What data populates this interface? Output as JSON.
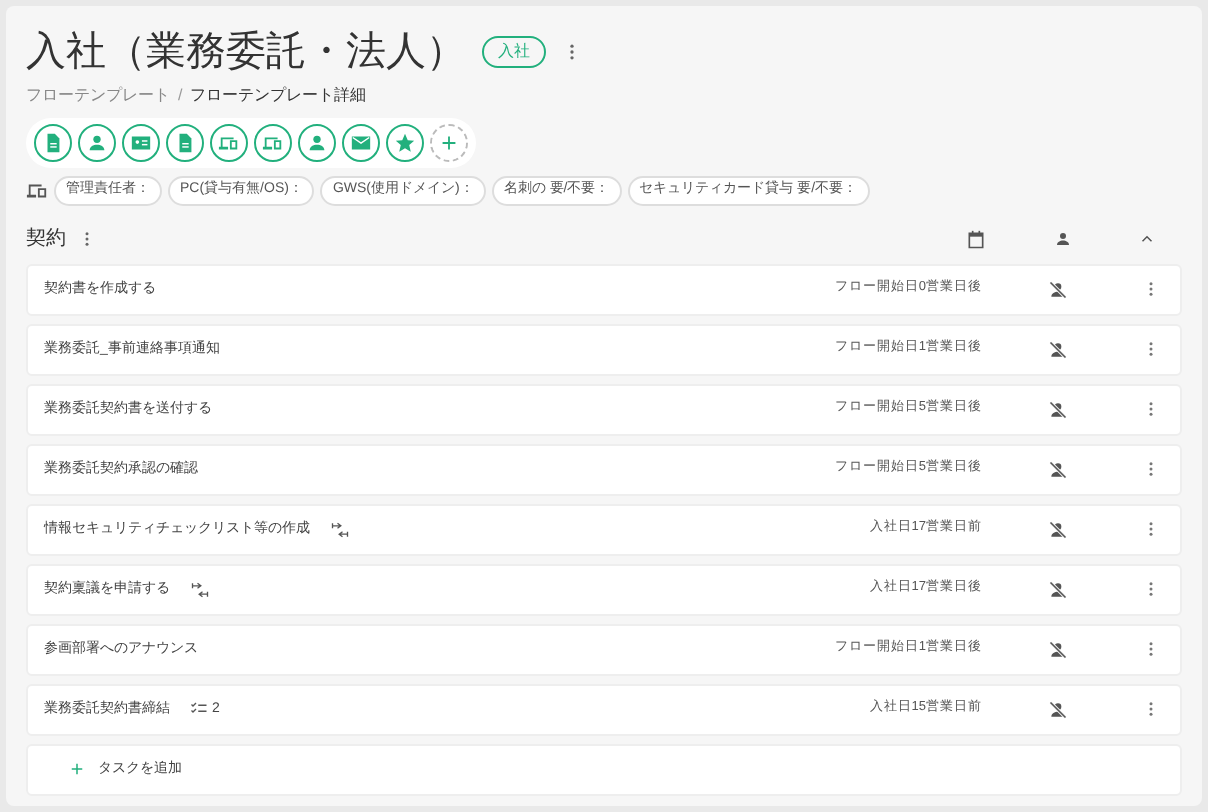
{
  "header": {
    "title": "入社（業務委託・法人）",
    "badge": "入社"
  },
  "breadcrumb": [
    {
      "label": "フローテンプレート",
      "current": false
    },
    {
      "label": "フローテンプレート詳細",
      "current": true
    }
  ],
  "breadcrumb_separator": "/",
  "action_icons": [
    {
      "kind": "document"
    },
    {
      "kind": "person"
    },
    {
      "kind": "id-card"
    },
    {
      "kind": "document"
    },
    {
      "kind": "devices"
    },
    {
      "kind": "devices"
    },
    {
      "kind": "person"
    },
    {
      "kind": "mail"
    },
    {
      "kind": "star"
    },
    {
      "kind": "add"
    }
  ],
  "tags": [
    "管理責任者：",
    "PC(貸与有無/OS)：",
    "GWS(使用ドメイン)：",
    "名刺の 要/不要：",
    "セキュリティカード貸与 要/不要："
  ],
  "section": {
    "title": "契約",
    "expanded": true
  },
  "tasks": [
    {
      "name": "契約書を作成する",
      "due": "フロー開始日0営業日後"
    },
    {
      "name": "業務委託_事前連絡事項通知",
      "due": "フロー開始日1営業日後"
    },
    {
      "name": "業務委託契約書を送付する",
      "due": "フロー開始日5営業日後"
    },
    {
      "name": "業務委託契約承認の確認",
      "due": "フロー開始日5営業日後"
    },
    {
      "name": "情報セキュリティチェックリスト等の作成",
      "badge": {
        "kind": "dependency"
      },
      "due": "入社日17営業日前"
    },
    {
      "name": "契約稟議を申請する",
      "badge": {
        "kind": "dependency"
      },
      "due": "入社日17営業日後"
    },
    {
      "name": "参画部署へのアナウンス",
      "due": "フロー開始日1営業日後"
    },
    {
      "name": "業務委託契約書締結",
      "badge": {
        "kind": "checklist",
        "count": "2"
      },
      "due": "入社日15営業日前"
    }
  ],
  "add_task": "タスクを追加"
}
